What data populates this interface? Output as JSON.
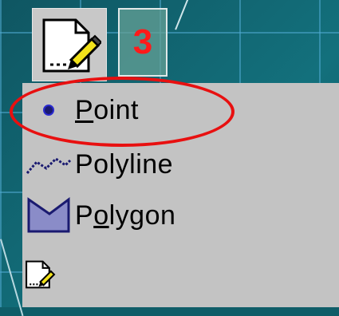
{
  "step_number": "3",
  "toolbar": {
    "tool_icon": "edit-feature-icon"
  },
  "menu": {
    "items": [
      {
        "label_first": "P",
        "label_rest": "oint",
        "icon": "point-icon"
      },
      {
        "label": "Polyline",
        "icon": "polyline-icon"
      },
      {
        "label_pre": "P",
        "label_underlined": "o",
        "label_rest": "lygon",
        "icon": "polygon-icon"
      },
      {
        "label": "",
        "icon": "edit-feature-icon"
      }
    ]
  },
  "colors": {
    "highlight": "#e81010",
    "step_number": "#ff1a1a",
    "menu_background": "#c3c3c3",
    "point_fill": "#1a1a70",
    "polygon_fill": "#8a8cc8"
  }
}
